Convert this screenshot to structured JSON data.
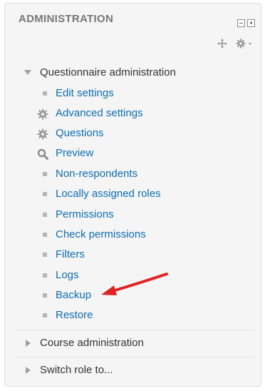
{
  "block": {
    "title": "ADMINISTRATION",
    "hide_control_icon": "hide-block-icon",
    "dock_control_icon": "dock-block-icon",
    "move_icon": "move-icon",
    "actions_icon": "gear-icon"
  },
  "questionnaire_admin": {
    "label": "Questionnaire administration",
    "expanded": true,
    "items": [
      {
        "label": "Edit settings",
        "icon": "bullet"
      },
      {
        "label": "Advanced settings",
        "icon": "gear-icon"
      },
      {
        "label": "Questions",
        "icon": "gear-icon"
      },
      {
        "label": "Preview",
        "icon": "magnifier-icon"
      },
      {
        "label": "Non-respondents",
        "icon": "bullet"
      },
      {
        "label": "Locally assigned roles",
        "icon": "bullet"
      },
      {
        "label": "Permissions",
        "icon": "bullet"
      },
      {
        "label": "Check permissions",
        "icon": "bullet"
      },
      {
        "label": "Filters",
        "icon": "bullet"
      },
      {
        "label": "Logs",
        "icon": "bullet"
      },
      {
        "label": "Backup",
        "icon": "bullet"
      },
      {
        "label": "Restore",
        "icon": "bullet"
      }
    ]
  },
  "course_admin": {
    "label": "Course administration",
    "expanded": false
  },
  "switch_role": {
    "label": "Switch role to...",
    "expanded": false
  },
  "colors": {
    "link": "#0d6db2",
    "annotation_arrow": "#e02424"
  }
}
